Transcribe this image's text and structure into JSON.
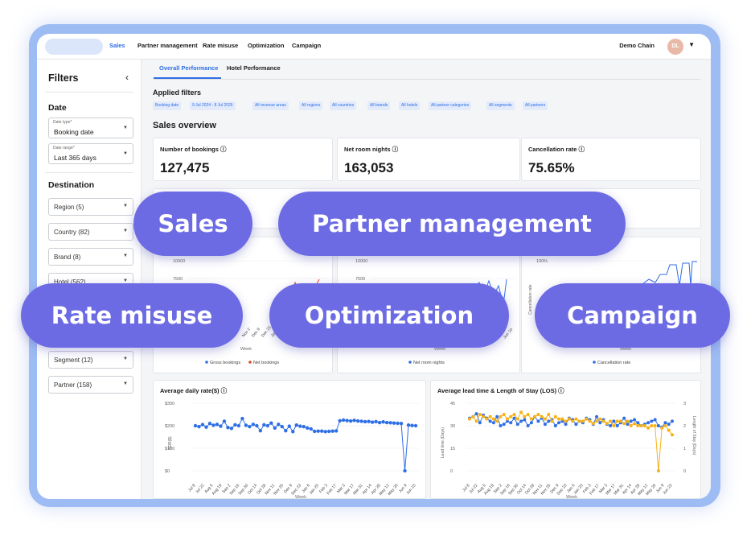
{
  "topbar": {
    "nav": [
      "Sales",
      "Partner management",
      "Rate misuse",
      "Optimization",
      "Campaign"
    ],
    "active_nav": "Sales",
    "account": "Demo Chain",
    "avatar_initials": "DL"
  },
  "sidebar": {
    "title": "Filters",
    "date_heading": "Date",
    "date_type": {
      "label": "Date type*",
      "value": "Booking date"
    },
    "date_range": {
      "label": "Date range*",
      "value": "Last 365 days"
    },
    "destination_heading": "Destination",
    "dropdowns": [
      "Region (5)",
      "Country (82)",
      "Brand (8)",
      "Hotel (562)",
      "Segment (12)",
      "Partner (158)"
    ]
  },
  "tabs": [
    "Overall Performance",
    "Hotel Performance"
  ],
  "applied_filters": {
    "title": "Applied filters",
    "chips": [
      "Booking date",
      "9 Jul 2024 - 8 Jul 2025",
      "All revenue areas",
      "All regions",
      "All countries",
      "All brands",
      "All hotels",
      "All partner categories",
      "All segments",
      "All partners"
    ]
  },
  "sales_overview": {
    "title": "Sales overview",
    "kpis": [
      {
        "label": "Number of bookings ⓘ",
        "value": "127,475"
      },
      {
        "label": "Net room nights ⓘ",
        "value": "163,053"
      },
      {
        "label": "Cancellation rate ⓘ",
        "value": "75.65%"
      }
    ]
  },
  "small_charts": {
    "bookings": {
      "y_ticks": [
        "10000",
        "7500"
      ],
      "xlabel": "Week",
      "legend": [
        "Gross bookings",
        "Net bookings"
      ],
      "x_ticks": [
        "Nov 2",
        "Dec 9",
        "Dec 23",
        "Jan 6"
      ]
    },
    "room_nights": {
      "y_ticks": [
        "10000",
        "7500"
      ],
      "ylabel": "nts",
      "xlabel": "Week",
      "legend": [
        "Net room nights"
      ],
      "x_ticks": [
        "Jun 10"
      ]
    },
    "cancellation": {
      "y_ticks": [
        "100%"
      ],
      "ylabel": "Cancellation rate",
      "xlabel": "Week",
      "legend": [
        "Cancellation rate"
      ]
    }
  },
  "adr_chart": {
    "title": "Average daily rate($) ⓘ",
    "ylabel": "ADR($)",
    "xlabel": "Week",
    "y_ticks": [
      "$300",
      "$200",
      "$100",
      "$0"
    ]
  },
  "lead_chart": {
    "title": "Average lead time & Length of Stay (LOS) ⓘ",
    "ylabel_left": "Lead time (Days)",
    "ylabel_right": "Length of Stay (Days)",
    "xlabel": "Week",
    "y_ticks_left": [
      "45",
      "30",
      "15",
      "0"
    ],
    "y_ticks_right": [
      "3",
      "2",
      "1",
      "0"
    ]
  },
  "x_ticks_weeks": [
    "Jul 8",
    "Jul 22",
    "Aug 5",
    "Aug 19",
    "Sep 2",
    "Sep 16",
    "Sep 30",
    "Oct 14",
    "Oct 28",
    "Nov 11",
    "Nov 25",
    "Dec 9",
    "Dec 23",
    "Jan 6",
    "Jan 20",
    "Feb 3",
    "Feb 17",
    "Mar 3",
    "Mar 17",
    "Mar 31",
    "Apr 14",
    "Apr 28",
    "May 12",
    "May 26",
    "Jun 9",
    "Jun 23"
  ],
  "overlay_pills": [
    "Sales",
    "Partner management",
    "Rate misuse",
    "Optimization",
    "Campaign"
  ],
  "colors": {
    "accent": "#2f6fe6",
    "pill": "#6c6be4",
    "series_orange": "#f5b21a",
    "series_red": "#e2461c"
  },
  "chart_data": [
    {
      "type": "line",
      "title": "Average daily rate($)",
      "xlabel": "Week",
      "ylabel": "ADR($)",
      "ylim": [
        0,
        300
      ],
      "series": [
        {
          "values": [
            200,
            196,
            205,
            194,
            210,
            202,
            206,
            198,
            220,
            192,
            188,
            204,
            200,
            232,
            202,
            196,
            206,
            200,
            178,
            204,
            200,
            212,
            190,
            206,
            196,
            178,
            198,
            174,
            203,
            198,
            196,
            190,
            186,
            175,
            176,
            176,
            174,
            175,
            176,
            177,
            222,
            225,
            223,
            221,
            224,
            221,
            220,
            218,
            219,
            216,
            218,
            214,
            217,
            214,
            213,
            212,
            211,
            210,
            0,
            203,
            201,
            200
          ]
        }
      ]
    },
    {
      "type": "line",
      "title": "Average lead time & Length of Stay (LOS)",
      "xlabel": "Week",
      "ylabel": "Lead time (Days)",
      "ylim": [
        0,
        45
      ],
      "y2lim": [
        0,
        3
      ],
      "series": [
        {
          "name": "Lead time",
          "values": [
            35,
            36,
            38,
            32,
            37,
            35,
            33,
            32,
            36,
            30,
            31,
            33,
            32,
            35,
            31,
            33,
            34,
            30,
            32,
            36,
            33,
            35,
            31,
            33,
            34,
            30,
            32,
            33,
            31,
            35,
            34,
            31,
            33,
            32,
            35,
            34,
            31,
            36,
            32,
            34,
            31,
            30,
            33,
            30,
            32,
            35,
            31,
            33,
            34,
            32,
            30,
            31,
            32,
            33,
            34,
            30,
            29,
            32,
            31,
            33
          ]
        },
        {
          "name": "Length of Stay",
          "values": [
            2.3,
            2.4,
            2.2,
            2.5,
            2.4,
            2.3,
            2.4,
            2.3,
            2.2,
            2.4,
            2.5,
            2.3,
            2.4,
            2.5,
            2.3,
            2.6,
            2.4,
            2.5,
            2.3,
            2.4,
            2.5,
            2.4,
            2.3,
            2.5,
            2.2,
            2.4,
            2.3,
            2.3,
            2.2,
            2.3,
            2.2,
            2.3,
            2.2,
            2.2,
            2.3,
            2.2,
            2.1,
            2.2,
            2.3,
            2.2,
            2.1,
            2.2,
            2.0,
            2.2,
            2.2,
            2.1,
            2.2,
            2.0,
            2.1,
            2.0,
            2.0,
            2.0,
            1.9,
            2.0,
            2.0,
            0,
            1.9,
            2.0,
            1.8,
            1.6
          ]
        }
      ]
    }
  ]
}
